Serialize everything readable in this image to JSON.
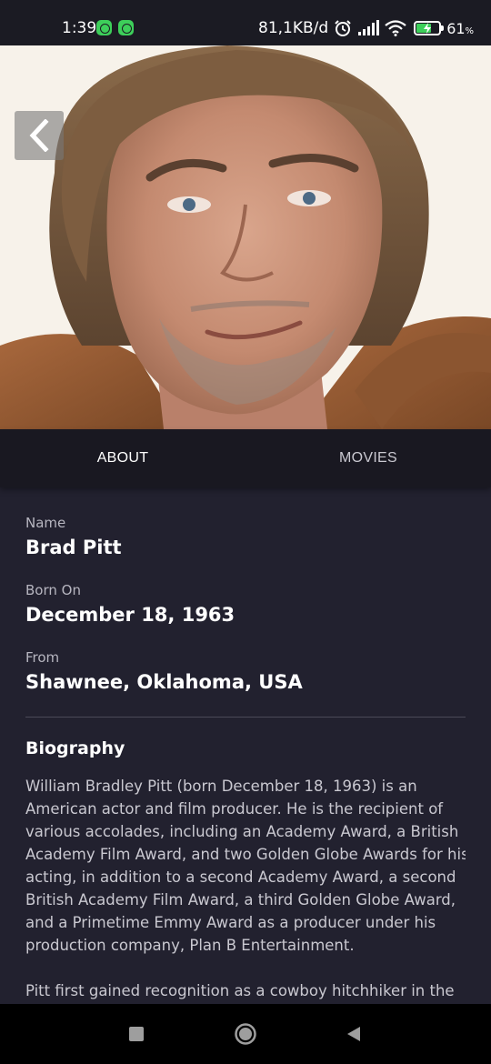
{
  "status_bar": {
    "time": "1:39",
    "network_speed": "81,1KB/d",
    "battery_percent": "61",
    "battery_unit": "%",
    "icons": [
      "app-notification-icon",
      "app-notification-icon",
      "alarm-icon",
      "signal-icon",
      "wifi-icon",
      "battery-charging-icon"
    ],
    "accent_color": "#3dcf5a"
  },
  "hero": {
    "image": "actor-portrait",
    "back_icon": "chevron-left-icon"
  },
  "tabs": [
    {
      "label": "ABOUT",
      "active": true
    },
    {
      "label": "MOVIES",
      "active": false
    }
  ],
  "about": {
    "name_label": "Name",
    "name_value": "Brad Pitt",
    "born_label": "Born On",
    "born_value": "December 18, 1963",
    "from_label": "From",
    "from_value": "Shawnee, Oklahoma, USA",
    "bio_heading": "Biography",
    "bio_paragraph_1": "William Bradley Pitt (born December 18, 1963) is an American actor and film producer. He is the recipient of various accolades, including an Academy Award, a British Academy Film Award, and two Golden Globe Awards for his acting, in addition to a second Academy Award, a second British Academy Film Award, a third Golden Globe Award, and a Primetime Emmy Award as a producer under his production company, Plan B Entertainment.",
    "bio_paragraph_2": "Pitt first gained recognition as a cowboy hitchhiker in the"
  },
  "nav_bar": {
    "icons": [
      "recents-square-icon",
      "home-circle-icon",
      "back-triangle-icon"
    ]
  },
  "colors": {
    "background": "#22212f",
    "tab_bar": "#191821",
    "text_primary": "#ffffff",
    "text_secondary": "#b7b6c0"
  }
}
